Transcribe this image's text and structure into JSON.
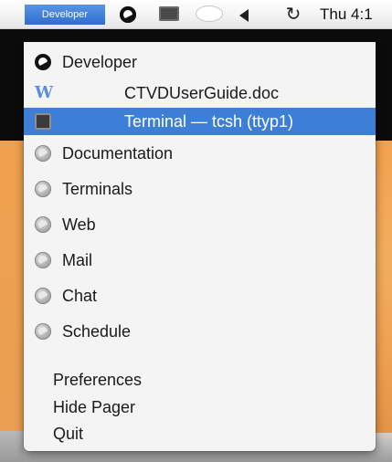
{
  "menubar": {
    "title": "Developer",
    "clock": "Thu 4:1",
    "icons": [
      "pager-icon",
      "screen-icon",
      "bubble-icon",
      "volume-icon",
      "sync-icon"
    ]
  },
  "menu": {
    "header": "Developer",
    "recent_items": [
      {
        "label": "CTVDUserGuide.doc",
        "icon": "word-doc-icon"
      },
      {
        "label": "Terminal — tcsh (ttyp1)",
        "icon": "terminal-icon",
        "selected": true
      }
    ],
    "desktops": [
      {
        "label": "Documentation"
      },
      {
        "label": "Terminals"
      },
      {
        "label": "Web"
      },
      {
        "label": "Mail"
      },
      {
        "label": "Chat"
      },
      {
        "label": "Schedule"
      }
    ],
    "commands": [
      {
        "label": "Preferences"
      },
      {
        "label": "Hide Pager"
      },
      {
        "label": "Quit"
      }
    ]
  },
  "colors": {
    "highlight": "#3d7fd6",
    "menubar_title_bg": "#2e6ed2",
    "desktop_orange": "#f2a24f"
  }
}
